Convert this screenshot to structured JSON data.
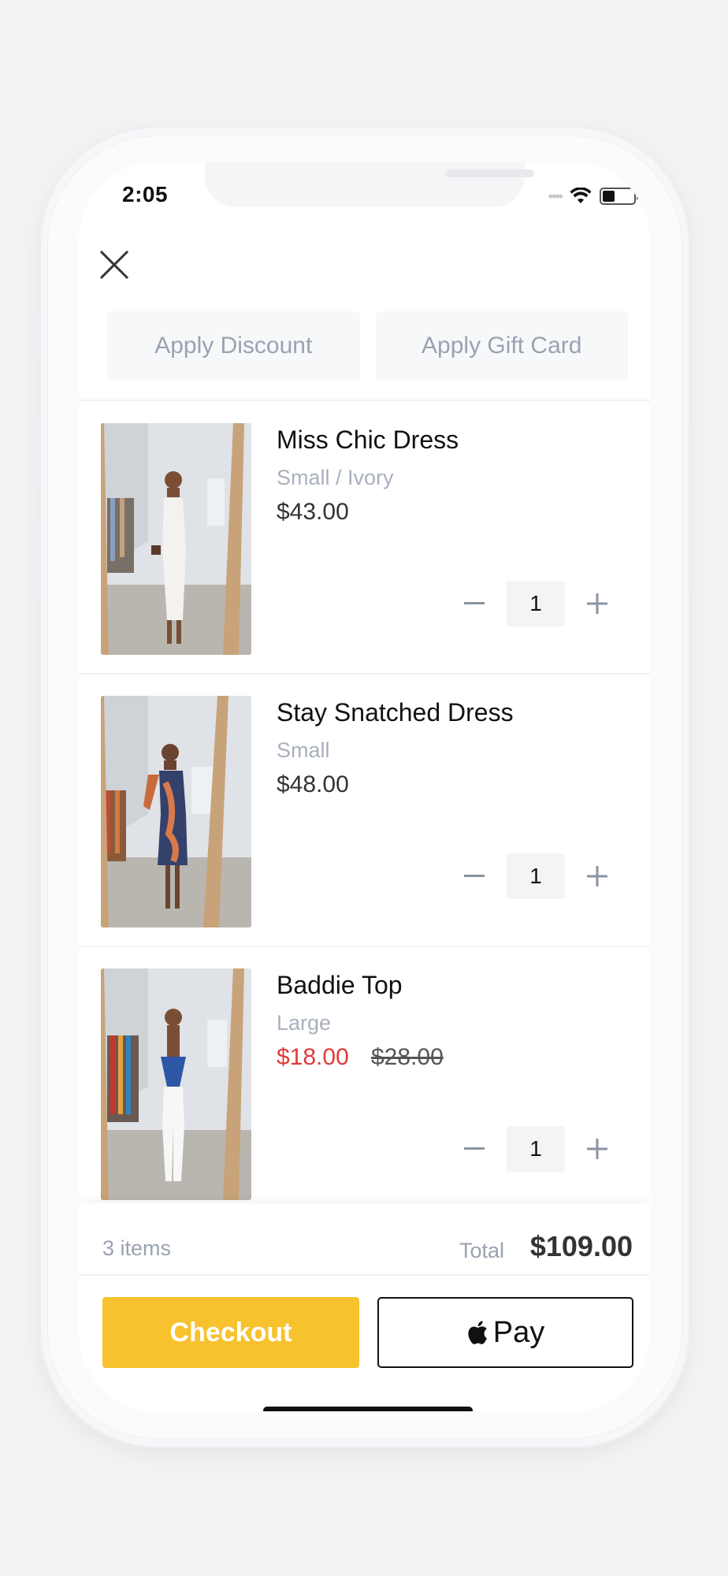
{
  "status_bar": {
    "time": "2:05",
    "battery_level": 0.4
  },
  "actions": {
    "discount_label": "Apply Discount",
    "gift_card_label": "Apply Gift Card"
  },
  "cart": {
    "items": [
      {
        "name": "Miss Chic Dress",
        "variant": "Small / Ivory",
        "price": "$43.00",
        "compare_price": "",
        "quantity": "1",
        "dress_color": "#f3f2ee"
      },
      {
        "name": "Stay Snatched Dress",
        "variant": "Small",
        "price": "$48.00",
        "compare_price": "",
        "quantity": "1",
        "dress_color": "#34416b"
      },
      {
        "name": "Baddie Top",
        "variant": "Large",
        "price": "$18.00",
        "compare_price": "$28.00",
        "quantity": "1",
        "dress_color": "#2d57a6"
      }
    ]
  },
  "summary": {
    "items_count": "3 items",
    "total_label": "Total",
    "total_value": "$109.00"
  },
  "buttons": {
    "checkout_label": "Checkout",
    "applepay_label": "Pay"
  },
  "colors": {
    "accent": "#f8c22e",
    "sale": "#e03b3b",
    "muted": "#9aa2b1"
  },
  "icons": {
    "close": "close-icon",
    "minus": "minus-icon",
    "plus": "plus-icon",
    "apple": "apple-icon",
    "wifi": "wifi-icon",
    "battery": "battery-icon"
  }
}
